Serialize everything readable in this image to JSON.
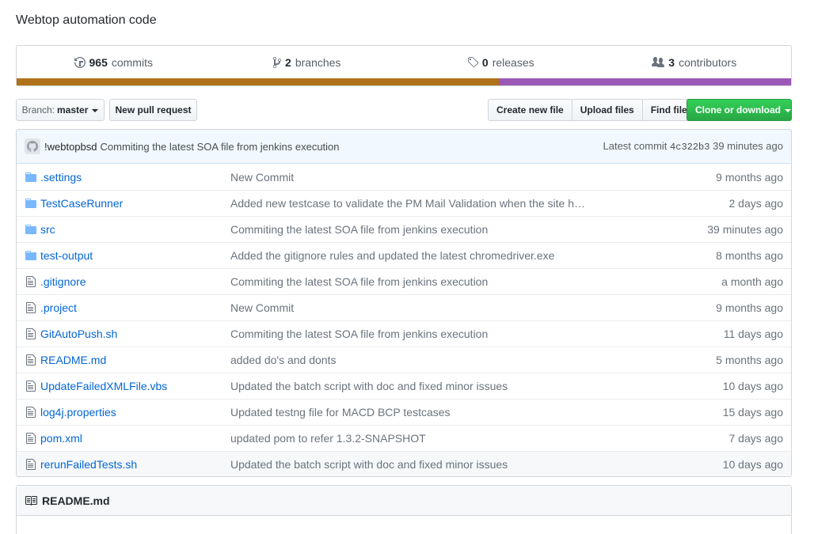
{
  "repo": {
    "description": "Webtop automation code"
  },
  "summary": {
    "commits": {
      "num": "965",
      "label": "commits",
      "icon": "history-icon"
    },
    "branches": {
      "num": "2",
      "label": "branches",
      "icon": "branch-icon"
    },
    "releases": {
      "num": "0",
      "label": "releases",
      "icon": "tag-icon"
    },
    "contributors": {
      "num": "3",
      "label": "contributors",
      "icon": "people-icon"
    },
    "languages": [
      {
        "color": "#b07219",
        "share": 62.3
      },
      {
        "color": "#9b59b6",
        "share": 37.7
      }
    ]
  },
  "toolbar": {
    "branch_prefix": "Branch:",
    "branch_value": "master",
    "new_pull_request": "New pull request",
    "create_new_file": "Create new file",
    "upload_files": "Upload files",
    "find_file": "Find file",
    "clone_or_download": "Clone or download"
  },
  "latest_commit": {
    "author": "!webtopbsd",
    "message": "Commiting the latest SOA file from jenkins execution",
    "prefix": "Latest commit",
    "sha": "4c322b3",
    "age": "39 minutes ago"
  },
  "files": [
    {
      "type": "dir",
      "name": ".settings",
      "message": "New Commit",
      "age": "9 months ago"
    },
    {
      "type": "dir",
      "name": "TestCaseRunner",
      "message": "Added new testcase to validate the PM Mail Validation when the site h…",
      "age": "2 days ago"
    },
    {
      "type": "dir",
      "name": "src",
      "message": "Commiting the latest SOA file from jenkins execution",
      "age": "39 minutes ago"
    },
    {
      "type": "dir",
      "name": "test-output",
      "message": "Added the gitignore rules and updated the latest chromedriver.exe",
      "age": "8 months ago"
    },
    {
      "type": "file",
      "name": ".gitignore",
      "message": "Commiting the latest SOA file from jenkins execution",
      "age": "a month ago"
    },
    {
      "type": "file",
      "name": ".project",
      "message": "New Commit",
      "age": "9 months ago"
    },
    {
      "type": "file",
      "name": "GitAutoPush.sh",
      "message": "Commiting the latest SOA file from jenkins execution",
      "age": "11 days ago"
    },
    {
      "type": "file",
      "name": "README.md",
      "message": "added do's and donts",
      "age": "5 months ago"
    },
    {
      "type": "file",
      "name": "UpdateFailedXMLFile.vbs",
      "message": "Updated the batch script with doc and fixed minor issues",
      "age": "10 days ago"
    },
    {
      "type": "file",
      "name": "log4j.properties",
      "message": "Updated testng file for MACD BCP testcases",
      "age": "15 days ago"
    },
    {
      "type": "file",
      "name": "pom.xml",
      "message": "updated pom to refer 1.3.2-SNAPSHOT",
      "age": "7 days ago"
    },
    {
      "type": "file",
      "name": "rerunFailedTests.sh",
      "message": "Updated the batch script with doc and fixed minor issues",
      "age": "10 days ago"
    }
  ],
  "readme": {
    "title": "README.md",
    "icon": "book-icon"
  }
}
